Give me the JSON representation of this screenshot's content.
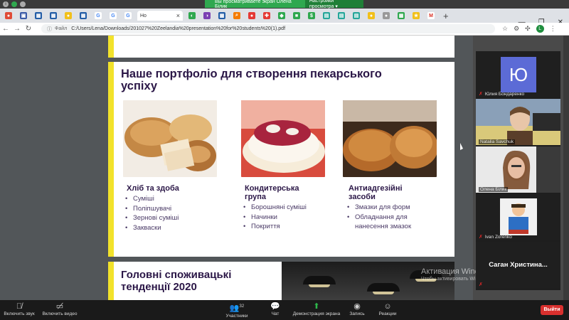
{
  "zoom": {
    "share_banner": "Вы просматриваете экран Олена Білик",
    "view_options": "Настройки просмотра ▾",
    "leave": "Выйти",
    "participants_count": "32",
    "controls": [
      {
        "icon": "mic-off-icon",
        "label": "Включить звук"
      },
      {
        "icon": "video-off-icon",
        "label": "Включить видео"
      },
      {
        "icon": "participants-icon",
        "label": "Участники"
      },
      {
        "icon": "chat-icon",
        "label": "Чат"
      },
      {
        "icon": "share-screen-icon",
        "label": "Демонстрация экрана"
      },
      {
        "icon": "record-icon",
        "label": "Запись"
      },
      {
        "icon": "reactions-icon",
        "label": "Реакции"
      }
    ],
    "participants": [
      {
        "name": "Юлия Бондаренко",
        "initial": "Ю",
        "muted": true
      },
      {
        "name": "Natalia Savchuk",
        "muted": false
      },
      {
        "name": "Олена Білик",
        "muted": false
      },
      {
        "name": "Ivan Zorenko",
        "muted": true
      },
      {
        "name": "",
        "muted": true
      }
    ],
    "speaker": "Саган Христина..."
  },
  "browser": {
    "url_scheme": "Файл",
    "url": "C:/Users/Lena/Downloads/201027%20Zeelandia%20presentation%20for%20students%20(1).pdf",
    "profile_initial": "L",
    "tab_label": "Ho"
  },
  "slide": {
    "title": "Наше портфоліо для створення пекарського успіху",
    "categories": [
      {
        "title": "Хліб та здоба",
        "items": [
          "Суміші",
          "Поліпшувачі",
          "Зернові суміші",
          "Закваски"
        ]
      },
      {
        "title": "Кондитерська група",
        "items": [
          "Борошняні суміші",
          "Начинки",
          "Покриття"
        ]
      },
      {
        "title": "Антиадгезійні засоби",
        "items": [
          "Змазки для форм",
          "Обладнання для нанесення змазок"
        ]
      }
    ]
  },
  "slide2": {
    "title": "Головні споживацькі тенденції 2020"
  },
  "watermark": {
    "title": "Активация Windows",
    "text": "Чтобы активировать Windows, перейдите в раздел"
  }
}
